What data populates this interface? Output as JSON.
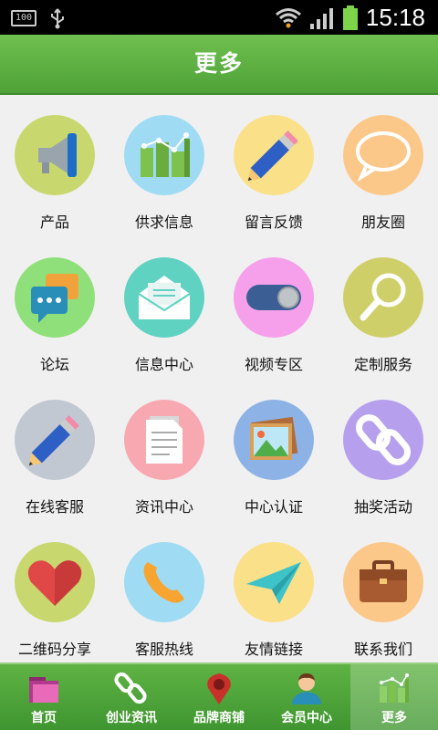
{
  "status_bar": {
    "battery_text": "100",
    "time": "15:18"
  },
  "header": {
    "title": "更多"
  },
  "grid": {
    "items": [
      {
        "label": "产品",
        "icon": "megaphone-icon",
        "bg": "#c8d86e"
      },
      {
        "label": "供求信息",
        "icon": "bar-chart-icon",
        "bg": "#9fdcf3"
      },
      {
        "label": "留言反馈",
        "icon": "pencil-icon",
        "bg": "#fbe08a"
      },
      {
        "label": "朋友圈",
        "icon": "speech-bubble-icon",
        "bg": "#fbc88a"
      },
      {
        "label": "论坛",
        "icon": "chat-bubbles-icon",
        "bg": "#8fe07a"
      },
      {
        "label": "信息中心",
        "icon": "envelope-icon",
        "bg": "#5fd2c2"
      },
      {
        "label": "视频专区",
        "icon": "toggle-icon",
        "bg": "#f6a0ec"
      },
      {
        "label": "定制服务",
        "icon": "magnifier-icon",
        "bg": "#cfcf6a"
      },
      {
        "label": "在线客服",
        "icon": "pencil-icon",
        "bg": "#c2c8d2"
      },
      {
        "label": "资讯中心",
        "icon": "document-icon",
        "bg": "#f8a8b0"
      },
      {
        "label": "中心认证",
        "icon": "picture-icon",
        "bg": "#8cb2e6"
      },
      {
        "label": "抽奖活动",
        "icon": "chain-link-icon",
        "bg": "#b6a0ee"
      },
      {
        "label": "二维码分享",
        "icon": "heart-icon",
        "bg": "#c8d86e"
      },
      {
        "label": "客服热线",
        "icon": "phone-icon",
        "bg": "#9fdcf3"
      },
      {
        "label": "友情链接",
        "icon": "paper-plane-icon",
        "bg": "#fbe08a"
      },
      {
        "label": "联系我们",
        "icon": "briefcase-icon",
        "bg": "#fbc88a"
      }
    ]
  },
  "tab_bar": {
    "tabs": [
      {
        "label": "首页",
        "icon": "folder-icon",
        "active": false
      },
      {
        "label": "创业资讯",
        "icon": "chain-link-icon",
        "active": false
      },
      {
        "label": "品牌商铺",
        "icon": "map-pin-icon",
        "active": false
      },
      {
        "label": "会员中心",
        "icon": "user-icon",
        "active": false
      },
      {
        "label": "更多",
        "icon": "bar-chart-icon",
        "active": true
      }
    ]
  }
}
